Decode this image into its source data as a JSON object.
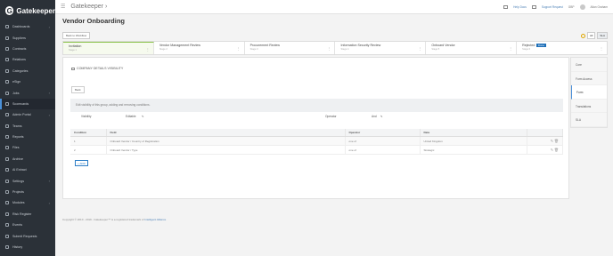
{
  "brand": {
    "name": "Gatekeeper",
    "logo_letter": "G"
  },
  "sidebar": {
    "items": [
      {
        "label": "Dashboards",
        "icon": "dashboard-icon",
        "caret": "›"
      },
      {
        "label": "Suppliers",
        "icon": "suppliers-icon"
      },
      {
        "label": "Contracts",
        "icon": "contracts-icon"
      },
      {
        "label": "Relations",
        "icon": "relations-icon"
      },
      {
        "label": "Categories",
        "icon": "categories-icon"
      },
      {
        "label": "eSign",
        "icon": "esign-icon"
      },
      {
        "label": "Jobs",
        "icon": "jobs-icon",
        "caret": "›"
      },
      {
        "label": "Scorecards",
        "icon": "scorecards-icon",
        "active": true
      },
      {
        "label": "Admin Portal",
        "icon": "admin-icon",
        "caret": "›"
      },
      {
        "label": "Teams",
        "icon": "teams-icon"
      },
      {
        "label": "Reports",
        "icon": "reports-icon"
      },
      {
        "label": "Files",
        "icon": "files-icon"
      },
      {
        "label": "Archive",
        "icon": "archive-icon"
      },
      {
        "label": "AI Extract",
        "icon": "ai-icon"
      },
      {
        "label": "Settings",
        "icon": "settings-icon",
        "caret": "›"
      },
      {
        "label": "Projects",
        "icon": "projects-icon"
      },
      {
        "label": "Modules",
        "icon": "modules-icon",
        "caret": "›"
      },
      {
        "label": "Risk Register",
        "icon": "risk-icon"
      },
      {
        "label": "Events",
        "icon": "events-icon"
      },
      {
        "label": "Submit Requests",
        "icon": "submit-icon"
      },
      {
        "label": "History",
        "icon": "history-icon"
      }
    ]
  },
  "topbar": {
    "title": "Gatekeeper",
    "title_caret": "›",
    "help": "Help Docs",
    "support": "Support Request",
    "lang": "GBP",
    "user": "Allan Graham"
  },
  "page": {
    "title": "Vendor Onboarding",
    "back_label": "Back to Workflow",
    "all_label": "All",
    "sla_label": "SLA"
  },
  "stages": [
    {
      "title": "Invitation",
      "sub": "Stage 1",
      "active": true
    },
    {
      "title": "Vendor Management Review",
      "sub": "Stage 2"
    },
    {
      "title": "Procurement Review",
      "sub": "Stage 3"
    },
    {
      "title": "Information Security Review",
      "sub": "Stage 4"
    },
    {
      "title": "Onboard Vendor",
      "sub": "Stage 5"
    },
    {
      "title": "Rejected",
      "sub": "Stage 6",
      "badge": "Done"
    }
  ],
  "panel": {
    "section_title": "COMPANY DETAILS VISIBILITY",
    "back_label": "Back",
    "info": "Edit visibility of this group, adding and removing conditions.",
    "visibility_label": "Visibility",
    "visibility_value": "Editable",
    "operator_label": "Operator",
    "operator_value": "And",
    "table": {
      "headers": [
        "Condition",
        "Field",
        "Operator",
        "Data",
        ""
      ],
      "rows": [
        {
          "condition": "1",
          "field": "Onboard Vendor / Country of Registration",
          "operator": "one of",
          "data": "United Kingdom"
        },
        {
          "condition": "2",
          "field": "Onboard Vendor / Type",
          "operator": "one of",
          "data": "Strategic"
        }
      ]
    },
    "add_label": "+ ADD"
  },
  "side_tabs": [
    {
      "label": "Core"
    },
    {
      "label": "Form Access"
    },
    {
      "label": "Form",
      "active": true
    },
    {
      "label": "Translations"
    },
    {
      "label": "SLA"
    }
  ],
  "footer": {
    "text": "Copyright © 2010 - 2019 - Gatekeeper™ is a registered trademark of",
    "link": "Intelligent Alliance"
  }
}
